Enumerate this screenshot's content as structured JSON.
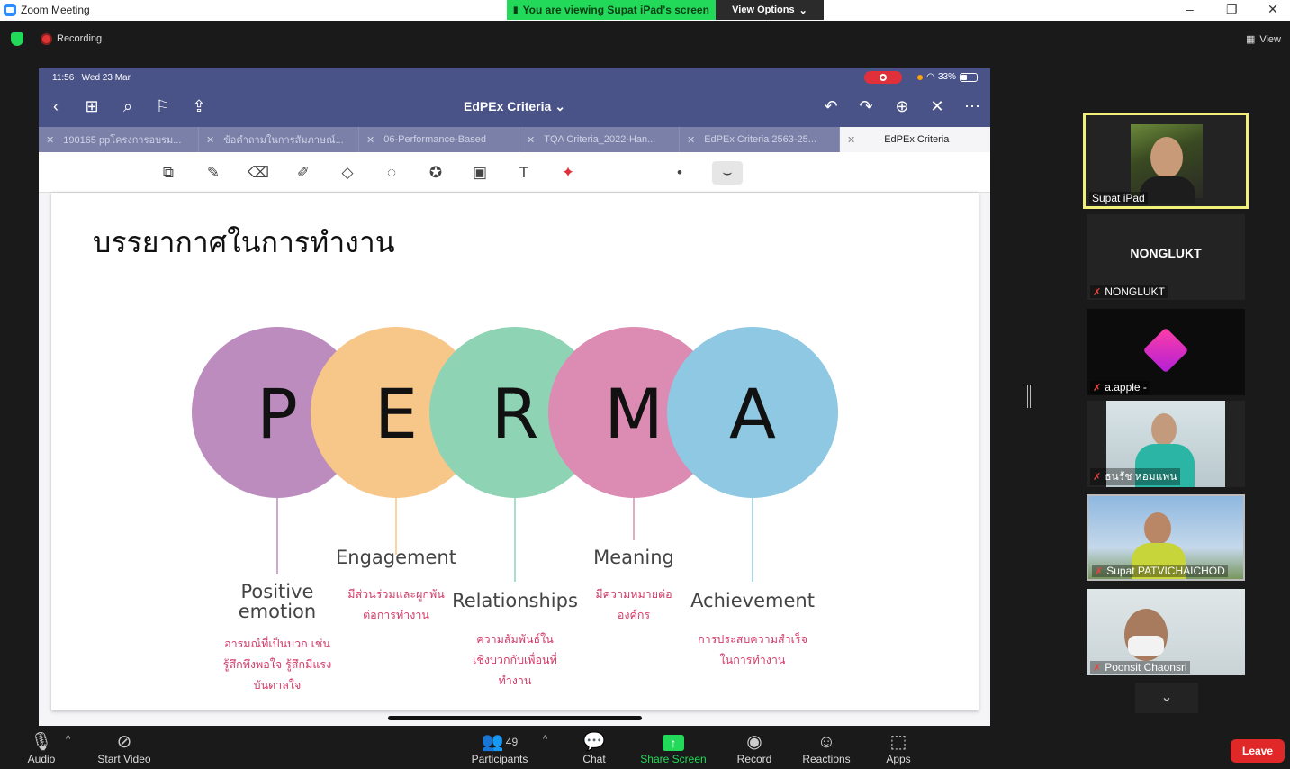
{
  "window": {
    "title": "Zoom Meeting",
    "share_banner": "You are viewing Supat iPad's screen",
    "view_options": "View Options",
    "minimize": "–",
    "restore": "❐",
    "close": "✕"
  },
  "infobar": {
    "recording_label": "Recording",
    "view_label": "View"
  },
  "ipad": {
    "status_time": "11:56",
    "status_date": "Wed 23 Mar",
    "battery": "33%",
    "app_title": "EdPEx Criteria",
    "tabs": [
      {
        "label": "190165 ppโครงการอบรม..."
      },
      {
        "label": "ข้อคำถามในการสัมภาษณ์..."
      },
      {
        "label": "06-Performance-Based"
      },
      {
        "label": "TQA Criteria_2022-Han..."
      },
      {
        "label": "EdPEx Criteria 2563-25..."
      },
      {
        "label": "EdPEx Criteria"
      }
    ]
  },
  "slide": {
    "title": "บรรยากาศในการทำงาน",
    "items": [
      {
        "letter": "P",
        "color": "#bd8cbf",
        "word_lines": [
          "Positive",
          "emotion"
        ],
        "thai_lines": [
          "อารมณ์ที่เป็นบวก เช่น",
          "รู้สึกพึงพอใจ รู้สึกมีแรง",
          "บันดาลใจ"
        ]
      },
      {
        "letter": "E",
        "color": "#f7c689",
        "word_lines": [
          "Engagement"
        ],
        "thai_lines": [
          "มีส่วนร่วมและผูกพัน",
          "ต่อการทำงาน"
        ]
      },
      {
        "letter": "R",
        "color": "#8fd3b5",
        "word_lines": [
          "Relationships"
        ],
        "thai_lines": [
          "ความสัมพันธ์ใน",
          "เชิงบวกกับเพื่อนที่",
          "ทำงาน"
        ]
      },
      {
        "letter": "M",
        "color": "#dc8cb2",
        "word_lines": [
          "Meaning"
        ],
        "thai_lines": [
          "มีความหมายต่อ",
          "องค์กร"
        ]
      },
      {
        "letter": "A",
        "color": "#8ec8e3",
        "word_lines": [
          "Achievement"
        ],
        "thai_lines": [
          "การประสบความสำเร็จ",
          "ในการทำงาน"
        ]
      }
    ]
  },
  "participants_panel": {
    "tiles": [
      {
        "name": "Supat iPad",
        "muted": false,
        "active": true
      },
      {
        "name": "NONGLUKT",
        "center_name": "NONGLUKT",
        "muted": true
      },
      {
        "name": "a.apple -",
        "muted": true
      },
      {
        "name": "ธนรัช หอมแพน",
        "muted": true
      },
      {
        "name": "Supat PATVICHAICHOD",
        "muted": true
      },
      {
        "name": "Poonsit Chaonsri",
        "muted": true
      }
    ]
  },
  "bottombar": {
    "audio": "Audio",
    "start_video": "Start Video",
    "participants": "Participants",
    "participants_count": "49",
    "chat": "Chat",
    "share_screen": "Share Screen",
    "record": "Record",
    "reactions": "Reactions",
    "apps": "Apps",
    "leave": "Leave"
  },
  "colors": {
    "share_green": "#23d959",
    "goodnotes_bar": "#4a5388",
    "leave_red": "#e02828",
    "active_speaker": "#f0f07a"
  }
}
